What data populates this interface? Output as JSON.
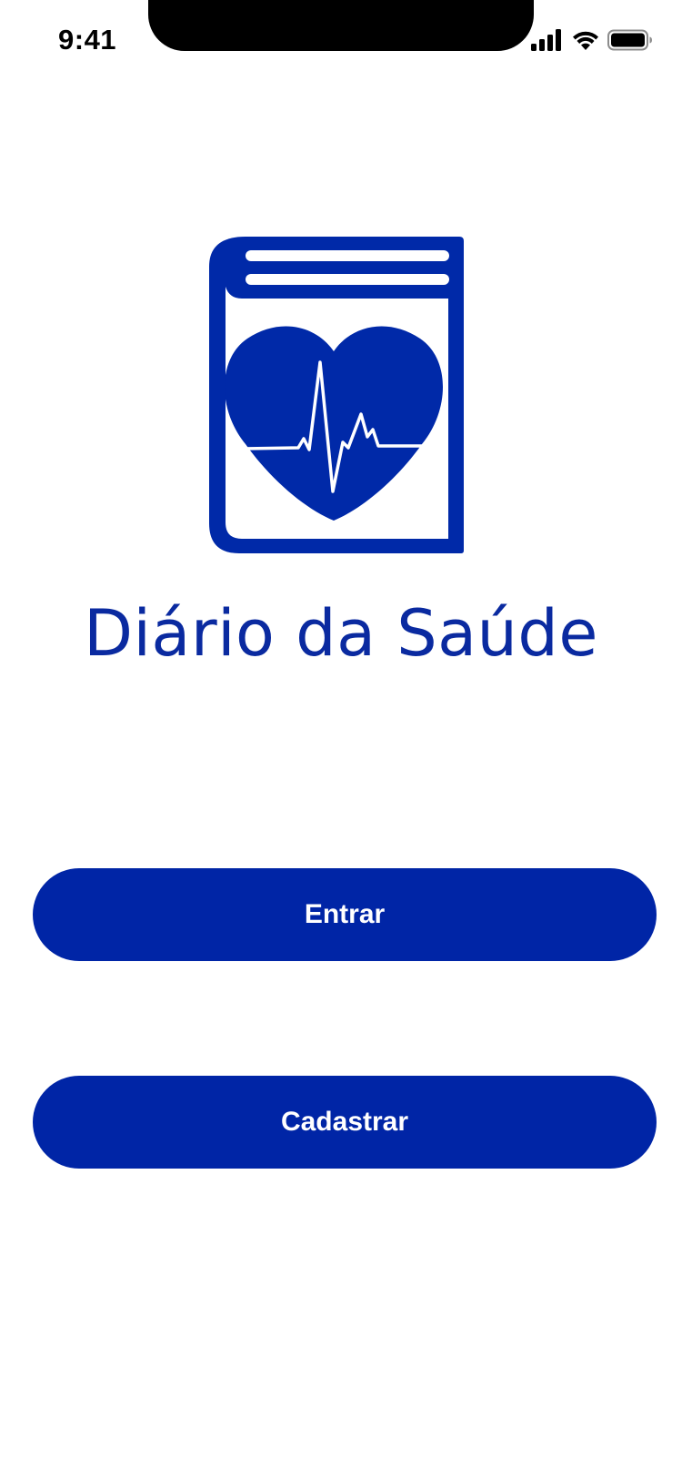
{
  "status_bar": {
    "time": "9:41",
    "icons": [
      "signal-icon",
      "wifi-icon",
      "battery-icon"
    ]
  },
  "logo": {
    "icon": "book-heart-heartbeat-logo"
  },
  "app": {
    "name": "Diário da Saúde"
  },
  "actions": {
    "enter_label": "Entrar",
    "register_label": "Cadastrar"
  },
  "colors": {
    "brand_blue": "#0025a6",
    "background": "#ffffff",
    "button_text": "#ffffff"
  }
}
